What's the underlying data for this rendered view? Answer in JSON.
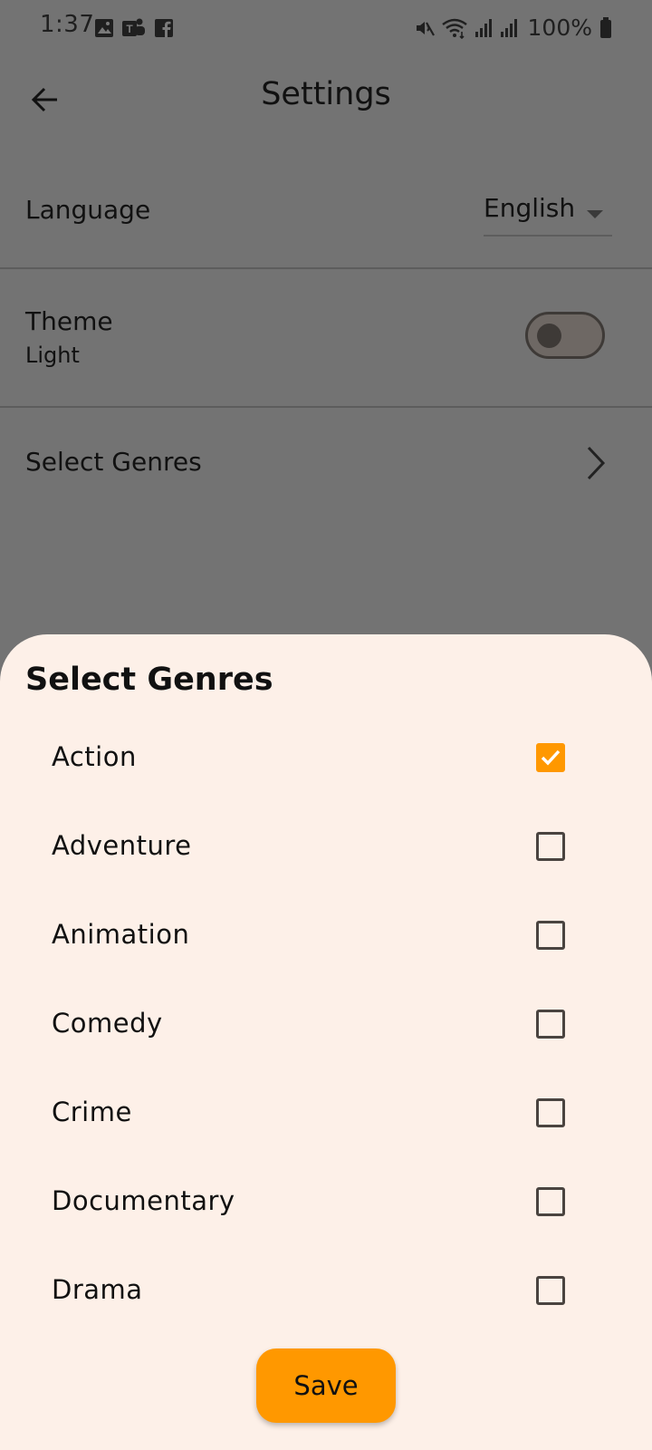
{
  "status_bar": {
    "time": "1:37",
    "battery": "100%",
    "left_icons": [
      "gallery-icon",
      "teams-icon",
      "facebook-icon"
    ],
    "right_icons": [
      "mute-icon",
      "wifi-icon",
      "signal-icon",
      "signal-icon-2",
      "battery-icon"
    ]
  },
  "app_bar": {
    "title": "Settings",
    "back_icon": "arrow-back-icon"
  },
  "settings": {
    "language_label": "Language",
    "language_value": "English",
    "theme_label": "Theme",
    "theme_value": "Light",
    "theme_toggle_on": false,
    "genres_label": "Select Genres"
  },
  "sheet": {
    "title": "Select Genres",
    "genres": [
      {
        "label": "Action",
        "checked": true
      },
      {
        "label": "Adventure",
        "checked": false
      },
      {
        "label": "Animation",
        "checked": false
      },
      {
        "label": "Comedy",
        "checked": false
      },
      {
        "label": "Crime",
        "checked": false
      },
      {
        "label": "Documentary",
        "checked": false
      },
      {
        "label": "Drama",
        "checked": false
      }
    ],
    "save_label": "Save"
  },
  "colors": {
    "accent": "#ff9800",
    "scrim_background": "#737373",
    "sheet_background": "#fdf0e8"
  }
}
